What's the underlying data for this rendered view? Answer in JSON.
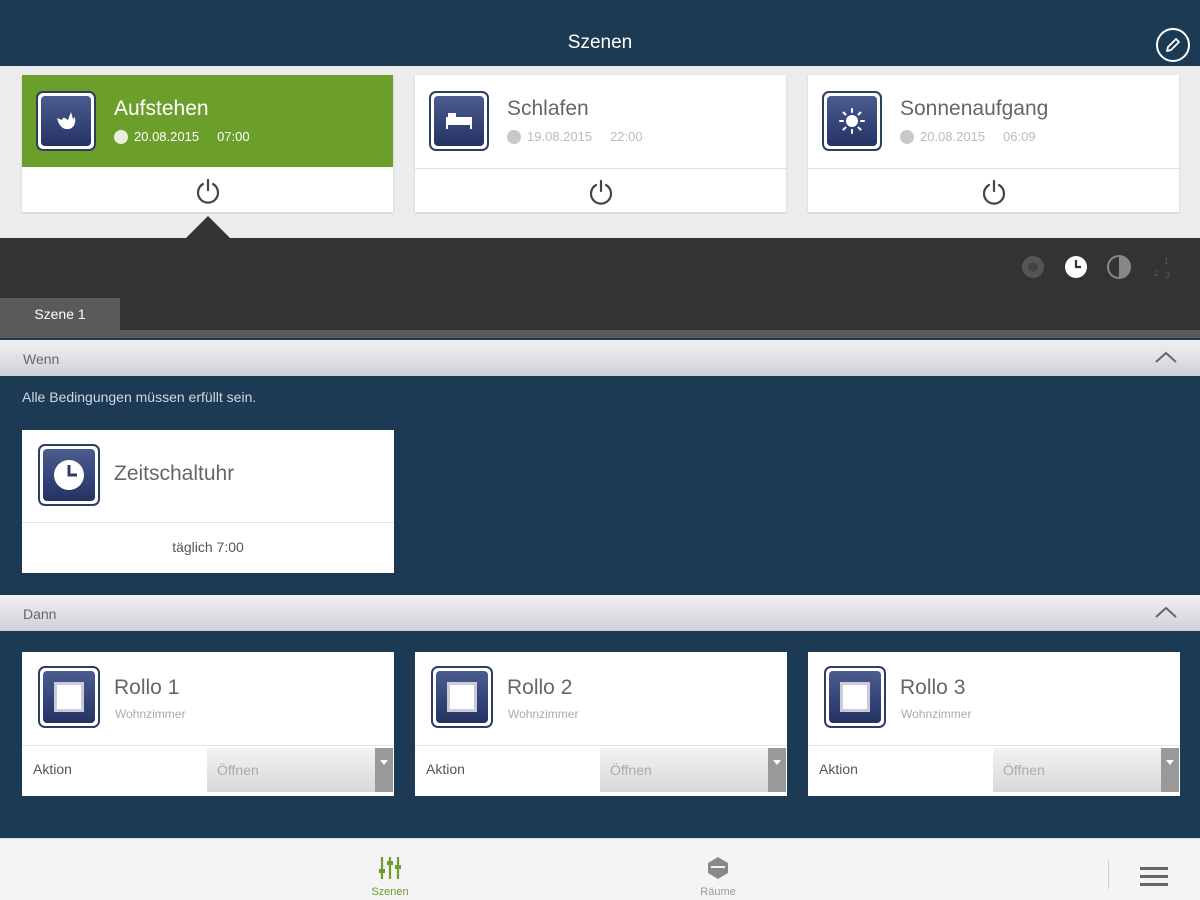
{
  "header": {
    "title": "Szenen"
  },
  "scenes": [
    {
      "name": "Aufstehen",
      "date": "20.08.2015",
      "time": "07:00",
      "active": true
    },
    {
      "name": "Schlafen",
      "date": "19.08.2015",
      "time": "22:00",
      "active": false
    },
    {
      "name": "Sonnenaufgang",
      "date": "20.08.2015",
      "time": "06:09",
      "active": false
    }
  ],
  "tabs": {
    "scene1": "Szene 1"
  },
  "wenn": {
    "label": "Wenn",
    "note": "Alle Bedingungen müssen erfüllt sein.",
    "timer": {
      "name": "Zeitschaltuhr",
      "schedule": "täglich 7:00"
    }
  },
  "dann": {
    "label": "Dann",
    "rollos": [
      {
        "name": "Rollo 1",
        "room": "Wohnzimmer",
        "action_label": "Aktion",
        "action_value": "Öffnen"
      },
      {
        "name": "Rollo 2",
        "room": "Wohnzimmer",
        "action_label": "Aktion",
        "action_value": "Öffnen"
      },
      {
        "name": "Rollo 3",
        "room": "Wohnzimmer",
        "action_label": "Aktion",
        "action_value": "Öffnen"
      }
    ]
  },
  "nav": {
    "scenes": "Szenen",
    "rooms": "Räume"
  },
  "colors": {
    "navy": "#1c3a54",
    "active_green": "#6c9e2c",
    "dark_bar": "#333333"
  }
}
